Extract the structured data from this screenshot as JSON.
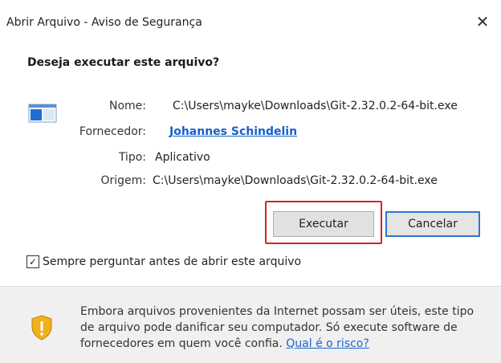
{
  "window": {
    "title": "Abrir Arquivo - Aviso de Segurança",
    "close_glyph": "✕"
  },
  "dialog": {
    "question": "Deseja executar este arquivo?",
    "file_icon": "application-window-icon",
    "fields": {
      "name_label": "Nome:",
      "name_value": "C:\\Users\\mayke\\Downloads\\Git-2.32.0.2-64-bit.exe",
      "publisher_label": "Fornecedor:",
      "publisher_value": "Johannes Schindelin",
      "type_label": "Tipo:",
      "type_value": "Aplicativo",
      "origin_label": "Origem:",
      "origin_value": "C:\\Users\\mayke\\Downloads\\Git-2.32.0.2-64-bit.exe"
    },
    "buttons": {
      "execute_label": "Executar",
      "cancel_label": "Cancelar"
    },
    "highlight_color": "#d62424",
    "checkbox": {
      "checked": true,
      "check_glyph": "✓",
      "label": "Sempre perguntar antes de abrir este arquivo"
    }
  },
  "footer": {
    "icon": "shield-warning-icon",
    "warning_text": "Embora arquivos provenientes da Internet possam ser úteis, este tipo de arquivo pode danificar seu computador. Só execute software de fornecedores em quem você confia.",
    "risk_link": "Qual é o risco?"
  }
}
